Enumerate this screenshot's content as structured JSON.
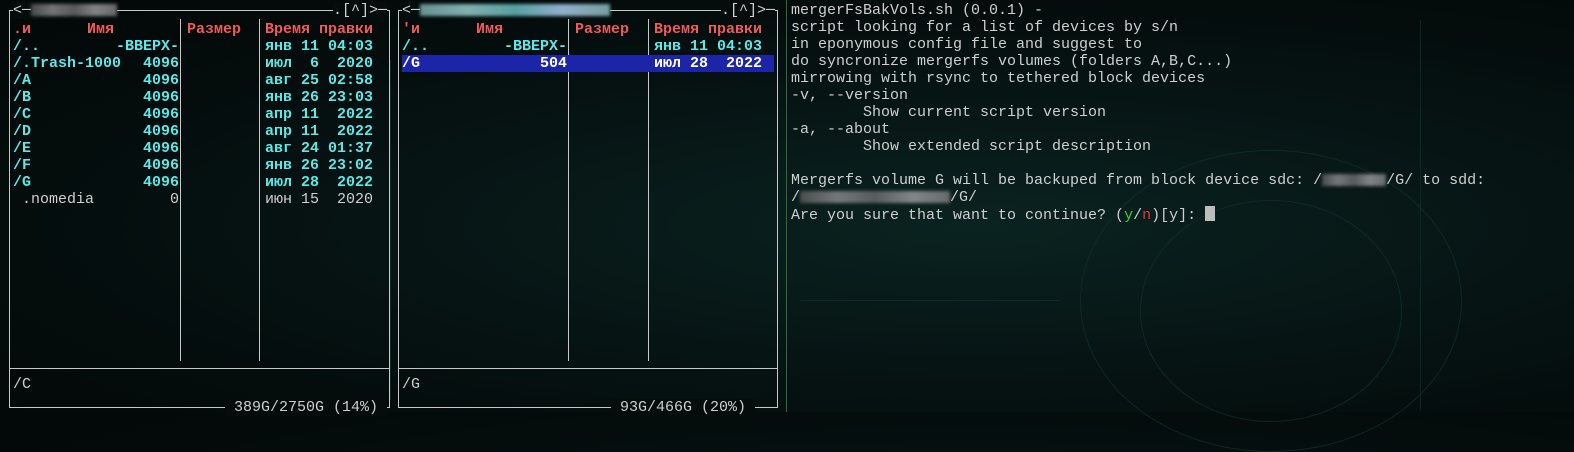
{
  "left_panel": {
    "header_left": "<─",
    "header_right": ".[^]>─",
    "columns": {
      "name_prefix": ".и",
      "name": "Имя",
      "size": "Размер",
      "mtime": "Время правки"
    },
    "rows": [
      {
        "name": "/..",
        "size": "-ВВЕРХ-",
        "mtime": "янв 11 04:03"
      },
      {
        "name": "/.Trash-1000",
        "size": "4096",
        "mtime": "июл  6  2020"
      },
      {
        "name": "/A",
        "size": "4096",
        "mtime": "авг 25 02:58"
      },
      {
        "name": "/B",
        "size": "4096",
        "mtime": "янв 26 23:03"
      },
      {
        "name": "/C",
        "size": "4096",
        "mtime": "апр 11  2022"
      },
      {
        "name": "/D",
        "size": "4096",
        "mtime": "апр 11  2022"
      },
      {
        "name": "/E",
        "size": "4096",
        "mtime": "авг 24 01:37"
      },
      {
        "name": "/F",
        "size": "4096",
        "mtime": "янв 26 23:02"
      },
      {
        "name": "/G",
        "size": "4096",
        "mtime": "июл 28  2022"
      },
      {
        "name": " .nomedia",
        "size": "0",
        "mtime": "июн 15  2020"
      }
    ],
    "status_path": "/C",
    "footer": " 389G/2750G (14%) "
  },
  "right_panel": {
    "header_left": "<─",
    "header_right": ".[^]>─",
    "columns": {
      "name_prefix": "'и",
      "name": "Имя",
      "size": "Размер",
      "mtime": "Время правки"
    },
    "rows": [
      {
        "name": "/..",
        "size": "-ВВЕРХ-",
        "mtime": "янв 11 04:03"
      },
      {
        "name": "/G",
        "size": "504",
        "mtime": "июл 28  2022"
      }
    ],
    "status_path": "/G",
    "footer": " 93G/466G (20%) "
  },
  "terminal": {
    "lines": [
      "mergerFsBakVols.sh (0.0.1) -",
      "script looking for a list of devices by s/n",
      "in eponymous config file and suggest to",
      "do syncronize mergerfs volumes (folders A,B,C...)",
      "mirrowing with rsync to tethered block devices",
      "-v, --version",
      "        Show current script version",
      "-a, --about",
      "        Show extended script description",
      ""
    ],
    "backup_line_start": "Mergerfs volume G will be backuped from block device sdc: /",
    "backup_line_mid": "/G/ to sdd:",
    "backup_line2_start": "/",
    "backup_line2_end": "/G/",
    "prompt_start": "Are you sure that want to continue? (",
    "prompt_y": "y",
    "prompt_slash": "/",
    "prompt_n": "n",
    "prompt_end": ")[y]: "
  }
}
